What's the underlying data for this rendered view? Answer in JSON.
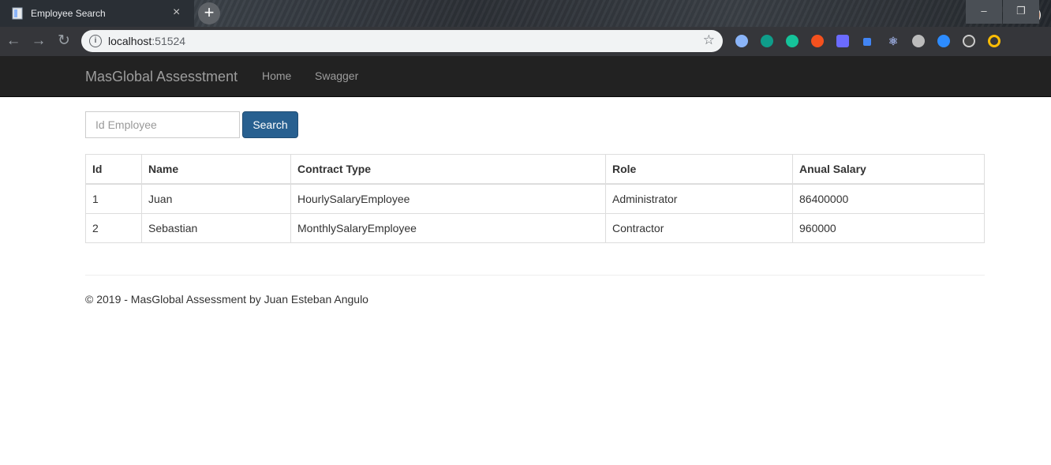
{
  "browser": {
    "tab_title": "Employee Search",
    "tab_close": "×",
    "new_tab": "+",
    "url_host": "localhost",
    "url_port": ":51524",
    "window_buttons": [
      "–",
      "❐"
    ]
  },
  "app": {
    "brand": "MasGlobal Assesstment",
    "nav": [
      "Home",
      "Swagger"
    ]
  },
  "search": {
    "placeholder": "Id Employee",
    "value": "",
    "button_label": "Search"
  },
  "table": {
    "headers": [
      "Id",
      "Name",
      "Contract Type",
      "Role",
      "Anual Salary"
    ],
    "rows": [
      [
        "1",
        "Juan",
        "HourlySalaryEmployee",
        "Administrator",
        "86400000"
      ],
      [
        "2",
        "Sebastian",
        "MonthlySalaryEmployee",
        "Contractor",
        "960000"
      ]
    ]
  },
  "footer": {
    "text": "© 2019 - MasGlobal Assessment by Juan Esteban Angulo"
  }
}
